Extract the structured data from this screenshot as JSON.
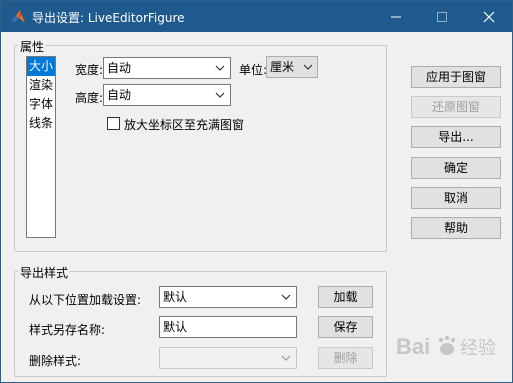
{
  "window": {
    "title": "导出设置: LiveEditorFigure",
    "controls": {
      "minimize": "—",
      "maximize": "☐",
      "close": "✕"
    }
  },
  "properties": {
    "group_label": "属性",
    "list_items": [
      {
        "label": "大小",
        "selected": true
      },
      {
        "label": "渲染",
        "selected": false
      },
      {
        "label": "字体",
        "selected": false
      },
      {
        "label": "线条",
        "selected": false
      }
    ],
    "width_label": "宽度:",
    "width_value": "自动",
    "unit_label": "单位:",
    "unit_value": "厘米",
    "height_label": "高度:",
    "height_value": "自动",
    "expand_checkbox_label": "放大坐标区至充满图窗",
    "expand_checked": false
  },
  "side_buttons": {
    "apply": "应用于图窗",
    "restore": "还原图窗",
    "export": "导出...",
    "ok": "确定",
    "cancel": "取消",
    "help": "帮助"
  },
  "export_styles": {
    "group_label": "导出样式",
    "load_label": "从以下位置加载设置:",
    "load_value": "默认",
    "load_button": "加载",
    "save_as_label": "样式另存名称:",
    "save_as_value": "默认",
    "save_button": "保存",
    "delete_label": "删除样式:",
    "delete_value": "",
    "delete_button": "删除"
  },
  "watermark": {
    "text": "Bai 经验"
  }
}
